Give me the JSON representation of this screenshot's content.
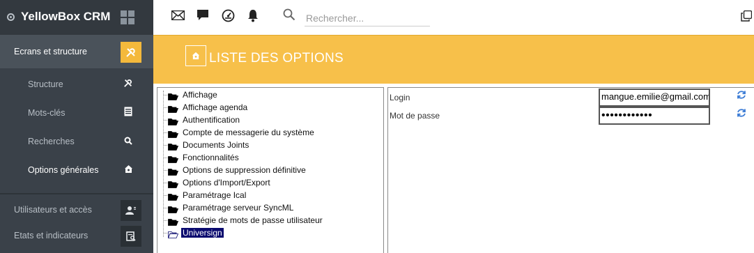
{
  "app": {
    "name": "YellowBox CRM"
  },
  "sidebar": {
    "active_section": "Ecrans et structure",
    "sub_items": [
      {
        "label": "Structure",
        "icon": "tools-icon"
      },
      {
        "label": "Mots-clés",
        "icon": "list-icon"
      },
      {
        "label": "Recherches",
        "icon": "search-icon"
      },
      {
        "label": "Options générales",
        "icon": "home-gear-icon",
        "current": true
      }
    ],
    "sections": [
      {
        "label": "Utilisateurs et accès",
        "icon": "user-admin-icon"
      },
      {
        "label": "Etats et indicateurs",
        "icon": "report-icon"
      }
    ]
  },
  "topbar": {
    "icons": [
      "mail-icon",
      "chat-icon",
      "dashboard-icon",
      "bell-icon"
    ],
    "search_placeholder": "Rechercher..."
  },
  "header": {
    "title": "LISTE DES OPTIONS"
  },
  "tree": {
    "items": [
      "Affichage",
      "Affichage agenda",
      "Authentification",
      "Compte de messagerie du système",
      "Documents Joints",
      "Fonctionnalités",
      "Options de suppression définitive",
      "Options d'Import/Export",
      "Paramétrage Ical",
      "Paramétrage serveur SyncML",
      "Stratégie de mots de passe utilisateur",
      "Universign"
    ],
    "selected": "Universign"
  },
  "form": {
    "login_label": "Login",
    "login_value": "mangue.emilie@gmail.com",
    "password_label": "Mot de passe",
    "password_value": "••••••••••••"
  },
  "colors": {
    "accent": "#f7c04a",
    "sidebar_bg": "#3a4149",
    "selection": "#0a0a6e",
    "refresh": "#3a7bd5"
  }
}
